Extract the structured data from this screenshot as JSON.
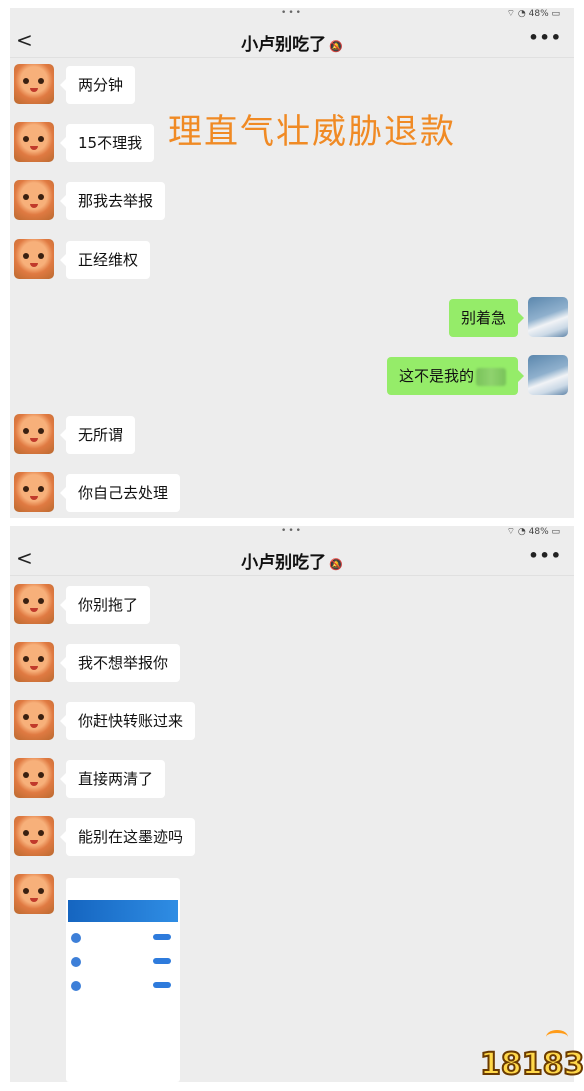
{
  "screens": [
    {
      "status": {
        "dots": "•••",
        "battery": "⌔ ◔ 48% ▭"
      },
      "nav": {
        "back": "<",
        "title": "小卢别吃了",
        "more": "•••"
      },
      "messages": [
        {
          "from": "them",
          "text": "两分钟"
        },
        {
          "from": "them",
          "text": "15不理我"
        },
        {
          "from": "them",
          "text": "那我去举报"
        },
        {
          "from": "them",
          "text": "正经维权"
        },
        {
          "from": "me",
          "text": "别着急"
        },
        {
          "from": "me",
          "text": "这不是我的"
        },
        {
          "from": "them",
          "text": "无所谓"
        },
        {
          "from": "them",
          "text": "你自己去处理"
        }
      ]
    },
    {
      "status": {
        "dots": "•••",
        "battery": "⌔ ◔ 48% ▭"
      },
      "nav": {
        "back": "<",
        "title": "小卢别吃了",
        "more": "•••"
      },
      "messages": [
        {
          "from": "them",
          "text": "你别拖了"
        },
        {
          "from": "them",
          "text": "我不想举报你"
        },
        {
          "from": "them",
          "text": "你赶快转账过来"
        },
        {
          "from": "them",
          "text": "直接两清了"
        },
        {
          "from": "them",
          "text": "能别在这墨迹吗"
        },
        {
          "from": "them",
          "type": "image"
        }
      ]
    }
  ],
  "overlay_caption": "理直气壮威胁退款",
  "watermark": "18183",
  "colors": {
    "incoming_bubble": "#ffffff",
    "outgoing_bubble": "#95ec69",
    "caption": "#f08a24",
    "background": "#ededed"
  }
}
